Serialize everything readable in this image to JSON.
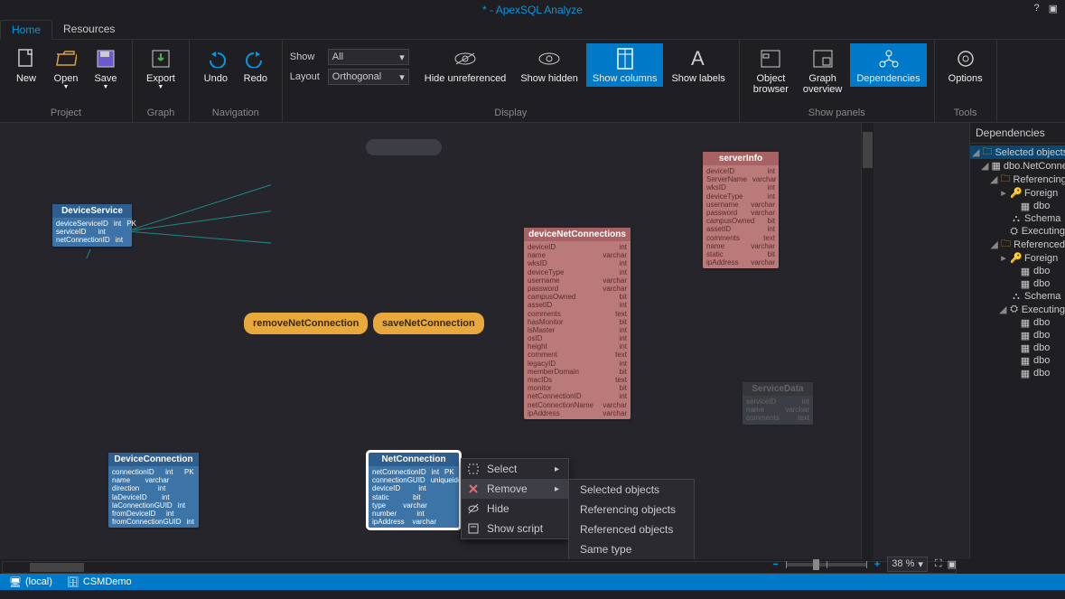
{
  "title": "* - ApexSQL Analyze",
  "tabs": {
    "home": "Home",
    "resources": "Resources"
  },
  "ribbon": {
    "groups": {
      "project": "Project",
      "graph": "Graph",
      "navigation": "Navigation",
      "display": "Display",
      "showpanels": "Show panels",
      "tools": "Tools"
    },
    "buttons": {
      "new": "New",
      "open": "Open",
      "save": "Save",
      "export": "Export",
      "undo": "Undo",
      "redo": "Redo",
      "hide_unreferenced": "Hide unreferenced",
      "show_hidden": "Show hidden",
      "show_columns": "Show columns",
      "show_labels": "Show labels",
      "object_browser": "Object\nbrowser",
      "graph_overview": "Graph\noverview",
      "dependencies": "Dependencies",
      "options": "Options"
    },
    "fields": {
      "show_label": "Show",
      "show_value": "All",
      "layout_label": "Layout",
      "layout_value": "Orthogonal"
    }
  },
  "nodes": {
    "deviceservice": {
      "title": "DeviceService",
      "cols": [
        [
          "deviceServiceID",
          "int",
          "PK"
        ],
        [
          "serviceID",
          "int",
          ""
        ],
        [
          "netConnectionID",
          "int",
          ""
        ]
      ]
    },
    "removenet": "removeNetConnection",
    "savenet": "saveNetConnection",
    "devicenet": {
      "title": "deviceNetConnections",
      "cols": [
        [
          "deviceID",
          "int"
        ],
        [
          "name",
          "varchar"
        ],
        [
          "wksID",
          "int"
        ],
        [
          "deviceType",
          "int"
        ],
        [
          "username",
          "varchar"
        ],
        [
          "password",
          "varchar"
        ],
        [
          "campusOwned",
          "bit"
        ],
        [
          "assetID",
          "int"
        ],
        [
          "comments",
          "text"
        ],
        [
          "hasMonitor",
          "bit"
        ],
        [
          "lsMaster",
          "int"
        ],
        [
          "osID",
          "int"
        ],
        [
          "height",
          "int"
        ],
        [
          "comment",
          "text"
        ],
        [
          "legacyID",
          "int"
        ],
        [
          "memberDomain",
          "bit"
        ],
        [
          "macIDs",
          "text"
        ],
        [
          "monitor",
          "bit"
        ],
        [
          "netConnectionID",
          "int"
        ],
        [
          "netConnectionName",
          "varchar"
        ],
        [
          "ipAddress",
          "varchar"
        ]
      ]
    },
    "serverinfo": {
      "title": "serverInfo",
      "cols": [
        [
          "deviceID",
          "int"
        ],
        [
          "ServerName",
          "varchar"
        ],
        [
          "wksID",
          "int"
        ],
        [
          "deviceType",
          "int"
        ],
        [
          "username",
          "varchar"
        ],
        [
          "password",
          "varchar"
        ],
        [
          "campusOwned",
          "bit"
        ],
        [
          "assetID",
          "int"
        ],
        [
          "comments",
          "text"
        ],
        [
          "name",
          "varchar"
        ],
        [
          "static",
          "bit"
        ],
        [
          "ipAddress",
          "varchar"
        ]
      ]
    },
    "deviceconn": {
      "title": "DeviceConnection",
      "cols": [
        [
          "connectionID",
          "int",
          "PK"
        ],
        [
          "name",
          "varchar",
          ""
        ],
        [
          "direction",
          "int",
          ""
        ],
        [
          "laDeviceID",
          "int",
          ""
        ],
        [
          "laConnectionGUID",
          "int",
          ""
        ],
        [
          "fromDeviceID",
          "int",
          ""
        ],
        [
          "fromConnectionGUID",
          "int",
          ""
        ]
      ]
    },
    "netconn": {
      "title": "NetConnection",
      "cols": [
        [
          "netConnectionID",
          "int",
          "PK"
        ],
        [
          "connectionGUID",
          "uniqueidentifier",
          ""
        ],
        [
          "deviceID",
          "int",
          ""
        ],
        [
          "static",
          "bit",
          ""
        ],
        [
          "type",
          "varchar",
          ""
        ],
        [
          "number",
          "int",
          ""
        ],
        [
          "ipAddress",
          "varchar",
          ""
        ]
      ]
    },
    "servicedata": {
      "title": "ServiceData",
      "cols": [
        [
          "serviceID",
          "int"
        ],
        [
          "name",
          "varchar"
        ],
        [
          "comments",
          "text"
        ]
      ]
    },
    "hiddenproc": "..."
  },
  "context_menu": {
    "select": "Select",
    "remove": "Remove",
    "hide": "Hide",
    "show_script": "Show script",
    "submenu": {
      "selected": "Selected objects",
      "referencing": "Referencing objects",
      "referenced": "Referenced objects",
      "same_type": "Same type"
    }
  },
  "rightpanel": {
    "title": "Dependencies",
    "tree": {
      "selected_objects": "Selected objects",
      "dbonet": "dbo.NetConnection",
      "refing": "Referencing",
      "refed": "Referenced",
      "foreign": "Foreign",
      "dbo": "dbo",
      "schema": "Schema",
      "execut": "Executing"
    }
  },
  "zoom": {
    "value": "38 %"
  },
  "status": {
    "server": "(local)",
    "db": "CSMDemo"
  }
}
